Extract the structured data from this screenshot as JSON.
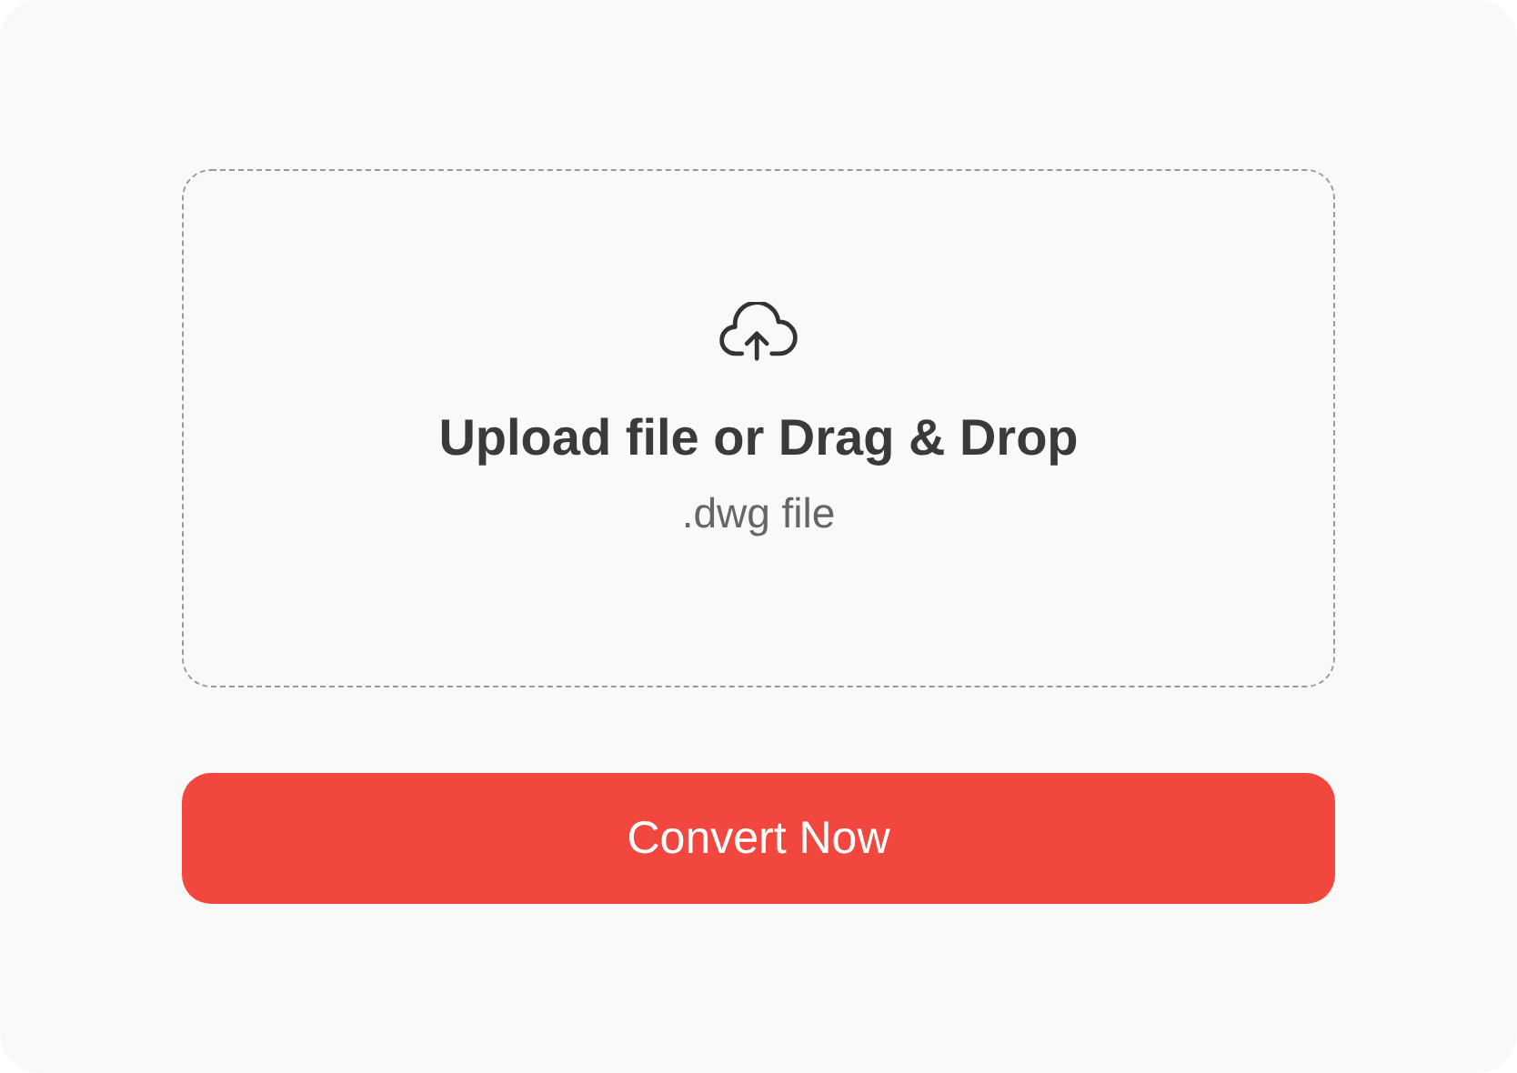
{
  "upload": {
    "title": "Upload file or Drag & Drop",
    "hint": ".dwg file"
  },
  "button": {
    "label": "Convert Now"
  }
}
